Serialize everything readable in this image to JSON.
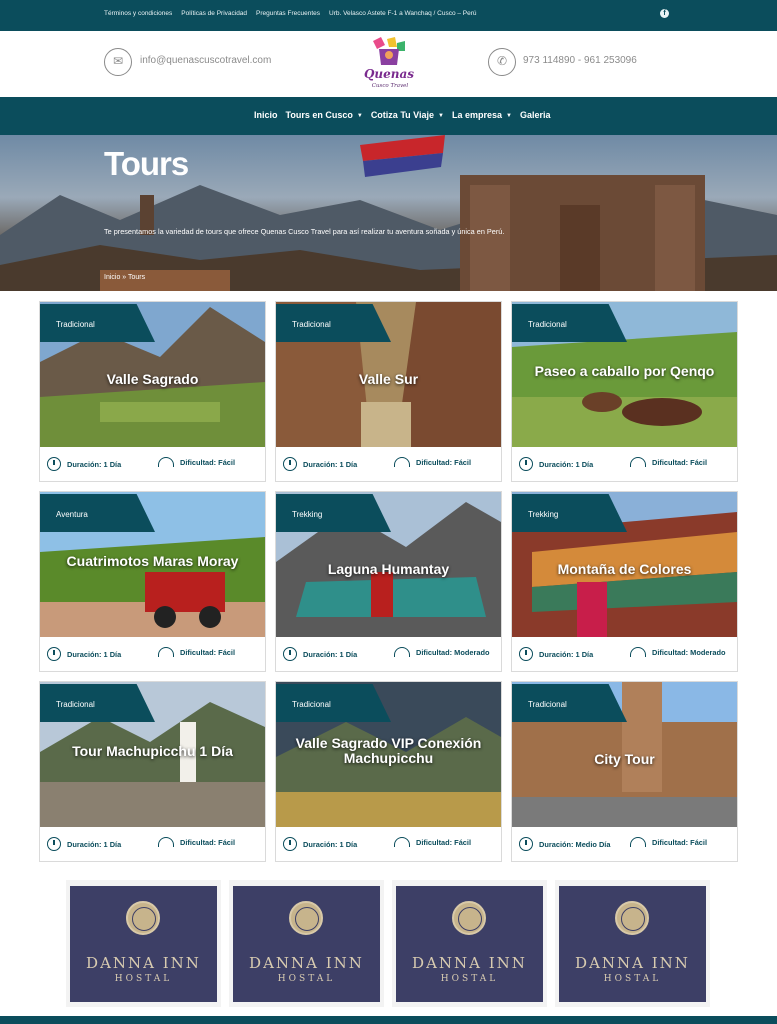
{
  "topbar": {
    "links": [
      "Términos y condiciones",
      "Políticas de Privacidad",
      "Preguntas Frecuentes",
      "Urb. Velasco Astete F-1 a Wanchaq / Cusco – Perú"
    ],
    "social_icon": "facebook-icon"
  },
  "header": {
    "email": "info@quenascuscotravel.com",
    "phone": "973 114890 - 961 253096",
    "logo_text_1": "Quenas",
    "logo_text_2": "Cusco Travel"
  },
  "nav": {
    "items": [
      {
        "label": "Inicio",
        "caret": false
      },
      {
        "label": "Tours en Cusco",
        "caret": true
      },
      {
        "label": "Cotiza Tu Viaje",
        "caret": true
      },
      {
        "label": "La empresa",
        "caret": true
      },
      {
        "label": "Galeria",
        "caret": false
      }
    ]
  },
  "hero": {
    "title": "Tours",
    "subtitle": "Te presentamos la variedad de tours que ofrece Quenas Cusco Travel para así realizar tu aventura soñada y única en Perú.",
    "breadcrumb": "Inicio » Tours"
  },
  "tours": [
    {
      "tag": "Tradicional",
      "title": "Valle Sagrado",
      "duration": "Duración: 1 Día",
      "difficulty": "Dificultad: Fácil"
    },
    {
      "tag": "Tradicional",
      "title": "Valle Sur",
      "duration": "Duración: 1 Día",
      "difficulty": "Dificultad: Fácil"
    },
    {
      "tag": "Tradicional",
      "title": "Paseo a caballo por Qenqo",
      "duration": "Duración: 1 Día",
      "difficulty": "Dificultad: Fácil"
    },
    {
      "tag": "Aventura",
      "title": "Cuatrimotos Maras Moray",
      "duration": "Duración: 1 Día",
      "difficulty": "Dificultad: Fácil"
    },
    {
      "tag": "Trekking",
      "title": "Laguna Humantay",
      "duration": "Duración: 1 Día",
      "difficulty": "Dificultad: Moderado"
    },
    {
      "tag": "Trekking",
      "title": "Montaña de Colores",
      "duration": "Duración: 1 Día",
      "difficulty": "Dificultad: Moderado"
    },
    {
      "tag": "Tradicional",
      "title": "Tour Machupicchu 1 Día",
      "duration": "Duración: 1 Día",
      "difficulty": "Dificultad: Fácil"
    },
    {
      "tag": "Tradicional",
      "title": "Valle Sagrado VIP Conexión Machupicchu",
      "duration": "Duración: 1 Día",
      "difficulty": "Dificultad: Fácil"
    },
    {
      "tag": "Tradicional",
      "title": "City Tour",
      "duration": "Duración: Medio Día",
      "difficulty": "Dificultad: Fácil"
    }
  ],
  "hotels": [
    {
      "name": "DANNA INN",
      "type": "HOSTAL"
    },
    {
      "name": "DANNA INN",
      "type": "HOSTAL"
    },
    {
      "name": "DANNA INN",
      "type": "HOSTAL"
    },
    {
      "name": "DANNA INN",
      "type": "HOSTAL"
    }
  ],
  "colors": {
    "brand": "#0b4d5c",
    "hotel_bg": "#3d3f66",
    "hotel_gold": "#d9ccb1"
  }
}
